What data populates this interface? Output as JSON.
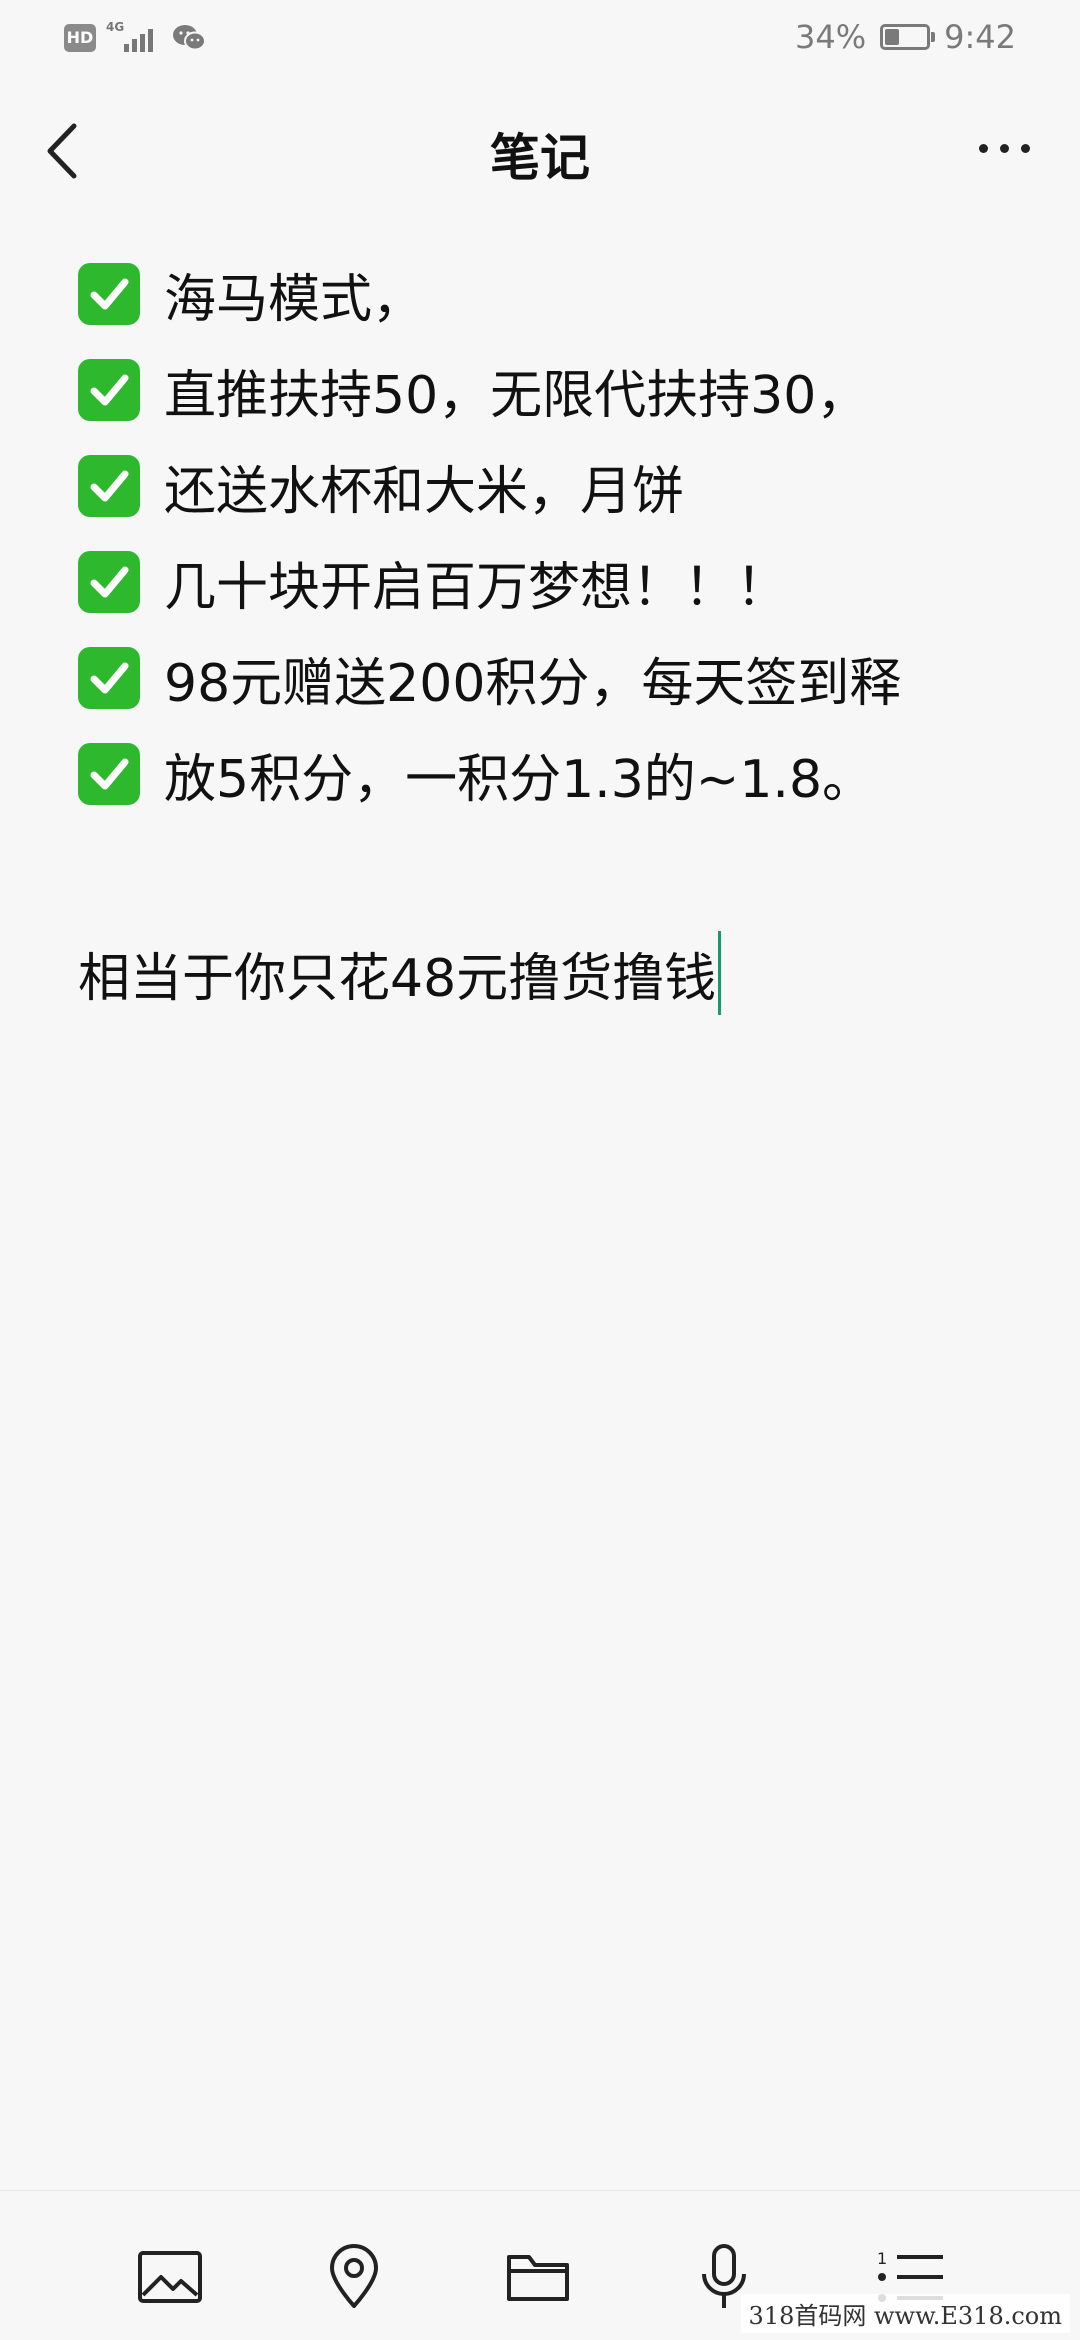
{
  "status_bar": {
    "hd_label": "HD",
    "network_type": "4G",
    "battery_percent": "34%",
    "battery_level": 0.34,
    "time": "9:42"
  },
  "header": {
    "title": "笔记",
    "back_icon": "chevron-left-icon",
    "more_icon": "more-dots-icon"
  },
  "note": {
    "check_lines": [
      "海马模式，",
      "直推扶持50，无限代扶持30，",
      "还送水杯和大米，月饼",
      "几十块开启百万梦想！！！",
      "98元赠送200积分，每天签到释",
      "放5积分，一积分1.3的~1.8。"
    ],
    "plain_line": "相当于你只花48元撸货撸钱"
  },
  "toolbar": {
    "icons": [
      "image-icon",
      "location-pin-icon",
      "folder-icon",
      "microphone-icon",
      "checklist-icon"
    ]
  },
  "watermark": "318首码网 www.E318.com",
  "colors": {
    "background": "#f7f7f7",
    "check_green": "#2eb82e",
    "caret": "#1a9a6a",
    "status_grey": "#7a7a7a"
  }
}
